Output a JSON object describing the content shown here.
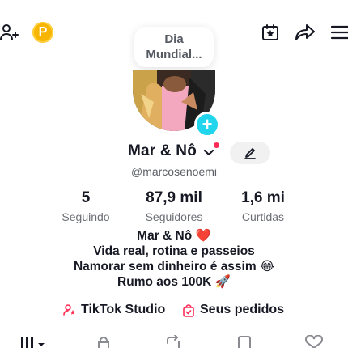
{
  "header": {
    "add_friend_icon": "person-add-icon",
    "coin_letter": "P",
    "note": {
      "line1": "Dia",
      "line2": "Mundial..."
    },
    "calendar_icon": "calendar-star-icon",
    "share_icon": "share-icon",
    "menu_icon": "menu-icon"
  },
  "profile": {
    "display_name": "Mar & Nô",
    "username": "@marcosenoemi",
    "avatar_add_symbol": "+"
  },
  "stats": [
    {
      "value": "5",
      "label": "Seguindo"
    },
    {
      "value": "87,9 mil",
      "label": "Seguidores"
    },
    {
      "value": "1,6 mi",
      "label": "Curtidas"
    }
  ],
  "bio": {
    "line1": "Mar & Nô ❤️",
    "line2": "Vida real, rotina e passeios",
    "line3": "Namorar sem dinheiro é assim 😂",
    "line4": "Rumo aos 100K 🚀"
  },
  "links": {
    "studio": "TikTok Studio",
    "orders": "Seus pedidos"
  },
  "colors": {
    "accent_red": "#fe2c55",
    "accent_cyan": "#20d5ec",
    "coin": "#f7b500"
  }
}
